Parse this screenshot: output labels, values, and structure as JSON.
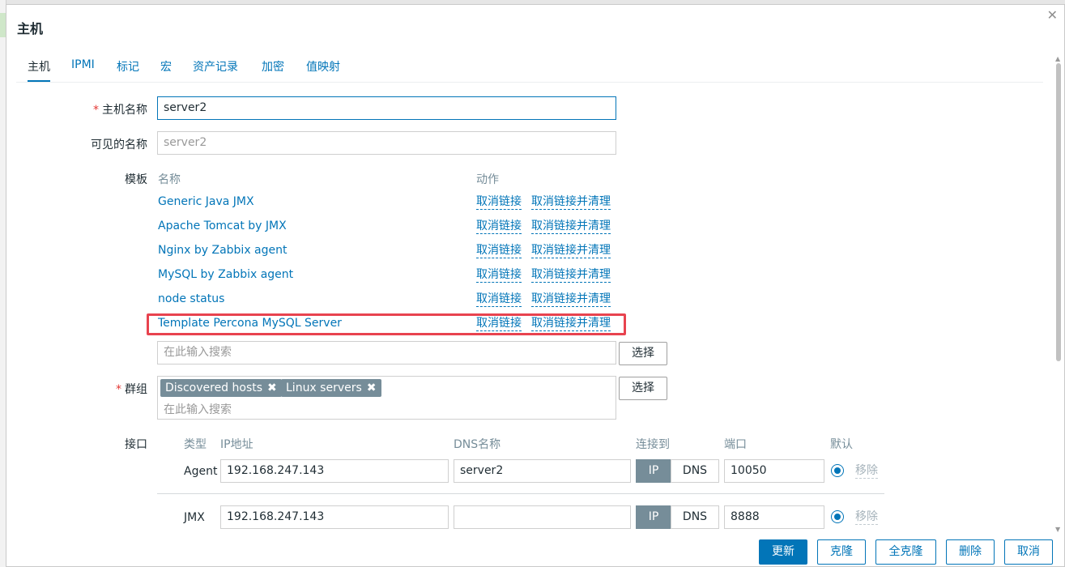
{
  "dialog": {
    "title": "主机"
  },
  "tabs": [
    {
      "label": "主机"
    },
    {
      "label": "IPMI"
    },
    {
      "label": "标记"
    },
    {
      "label": "宏"
    },
    {
      "label": "资产记录"
    },
    {
      "label": "加密"
    },
    {
      "label": "值映射"
    }
  ],
  "form": {
    "host_name_label": "主机名称",
    "host_name_value": "server2",
    "visible_name_label": "可见的名称",
    "visible_name_placeholder": "server2",
    "templates_label": "模板",
    "templates_col_name": "名称",
    "templates_col_action": "动作",
    "templates": [
      {
        "name": "Generic Java JMX",
        "unlink": "取消链接",
        "unlink_clear": "取消链接并清理"
      },
      {
        "name": "Apache Tomcat by JMX",
        "unlink": "取消链接",
        "unlink_clear": "取消链接并清理"
      },
      {
        "name": "Nginx by Zabbix agent",
        "unlink": "取消链接",
        "unlink_clear": "取消链接并清理"
      },
      {
        "name": "MySQL by Zabbix agent",
        "unlink": "取消链接",
        "unlink_clear": "取消链接并清理"
      },
      {
        "name": "node status",
        "unlink": "取消链接",
        "unlink_clear": "取消链接并清理"
      },
      {
        "name": "Template Percona MySQL Server",
        "unlink": "取消链接",
        "unlink_clear": "取消链接并清理"
      }
    ],
    "template_search_placeholder": "在此输入搜索",
    "select_label": "选择",
    "groups_label": "群组",
    "groups": [
      {
        "label": "Discovered hosts"
      },
      {
        "label": "Linux servers"
      }
    ],
    "groups_search_placeholder": "在此输入搜索",
    "interfaces_label": "接口",
    "interfaces_headers": {
      "type": "类型",
      "ip": "IP地址",
      "dns": "DNS名称",
      "connect": "连接到",
      "port": "端口",
      "default": "默认"
    },
    "interfaces": [
      {
        "type": "Agent",
        "ip": "192.168.247.143",
        "dns": "server2",
        "ip_btn": "IP",
        "dns_btn": "DNS",
        "port": "10050",
        "remove": "移除"
      },
      {
        "type": "JMX",
        "ip": "192.168.247.143",
        "dns": "",
        "ip_btn": "IP",
        "dns_btn": "DNS",
        "port": "8888",
        "remove": "移除"
      }
    ]
  },
  "footer": {
    "update": "更新",
    "clone": "克隆",
    "full_clone": "全克隆",
    "delete": "删除",
    "cancel": "取消"
  },
  "colors": {
    "accent": "#0275b8",
    "highlight_box": "#e8434f",
    "chip": "#768d99"
  }
}
